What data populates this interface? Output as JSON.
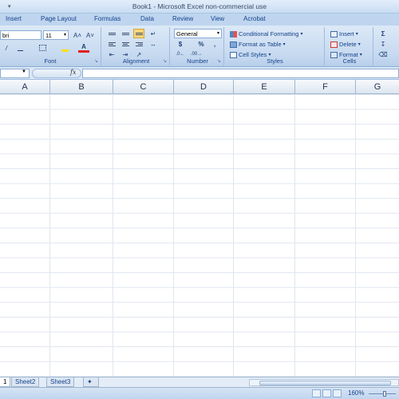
{
  "window": {
    "title": "Book1 - Microsoft Excel non-commercial use"
  },
  "ribbon": {
    "tabs": [
      {
        "label": "Insert"
      },
      {
        "label": "Page Layout"
      },
      {
        "label": "Formulas"
      },
      {
        "label": "Data"
      },
      {
        "label": "Review"
      },
      {
        "label": "View"
      },
      {
        "label": "Acrobat"
      }
    ],
    "font": {
      "name": "bri",
      "size": "11",
      "label": "Font",
      "grow_icon": "A˄",
      "shrink_icon": "A˅",
      "font_color_glyph": "A"
    },
    "alignment": {
      "label": "Alignment"
    },
    "number": {
      "format": "General",
      "currency": "$",
      "percent": "%",
      "comma": ",",
      "label": "Number"
    },
    "styles": {
      "conditional": "Conditional Formatting",
      "format_table": "Format as Table",
      "cell_styles": "Cell Styles",
      "label": "Styles"
    },
    "cells": {
      "insert": "Insert",
      "delete": "Delete",
      "format": "Format",
      "label": "Cells"
    },
    "editing": {
      "sum_glyph": "Σ"
    }
  },
  "formula_bar": {
    "fx": "fx"
  },
  "grid": {
    "columns": [
      "A",
      "B",
      "C",
      "D",
      "E",
      "F",
      "G"
    ]
  },
  "sheets": [
    {
      "label": "1"
    },
    {
      "label": "Sheet2"
    },
    {
      "label": "Sheet3"
    }
  ],
  "status": {
    "zoom": "160%"
  },
  "colors": {
    "ribbon": "#c7daf0",
    "accent": "#15428b",
    "selected": "#f9d77c"
  }
}
